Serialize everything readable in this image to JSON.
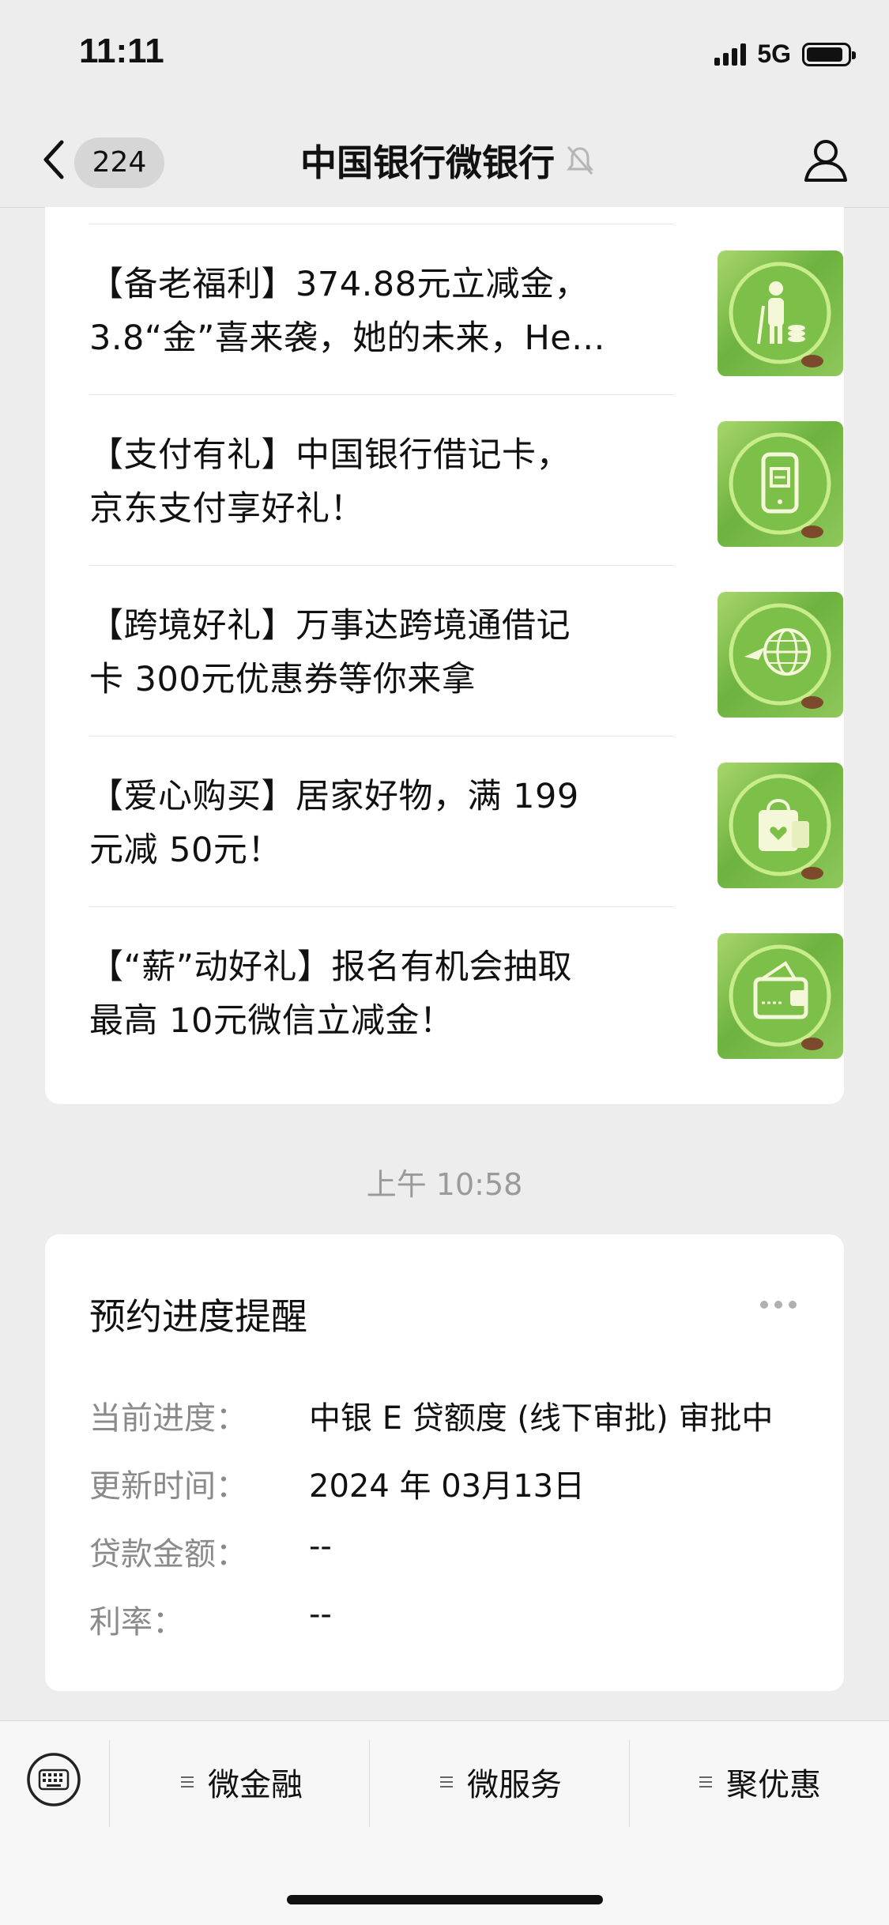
{
  "status_bar": {
    "time": "11:11",
    "network": "5G",
    "battery_level": 0.9
  },
  "nav": {
    "unread_count": "224",
    "title": "中国银行微银行",
    "icons": [
      "back-icon",
      "mute-bell-icon",
      "profile-icon"
    ]
  },
  "articles": [
    {
      "line1": "【备老福利】374.88元立减金，",
      "line2": "3.8“金”喜来袭，她的未来，He...",
      "icon": "elderly-person-coins-icon"
    },
    {
      "line1": "【支付有礼】中国银行借记卡，",
      "line2": "京东支付享好礼！",
      "icon": "mobile-payment-icon"
    },
    {
      "line1": "【跨境好礼】万事达跨境通借记",
      "line2": "卡 300元优惠券等你来拿",
      "icon": "globe-airplane-icon"
    },
    {
      "line1": "【爱心购买】居家好物，满 199",
      "line2": "元减 50元！",
      "icon": "shopping-bag-heart-icon"
    },
    {
      "line1": "【“薪”动好礼】报名有机会抽取",
      "line2": "最高 10元微信立减金！",
      "icon": "wallet-icon"
    }
  ],
  "time_separator": "上午 10:58",
  "reminder": {
    "title": "预约进度提醒",
    "fields": [
      {
        "label": "当前进度：",
        "value": "中银 E 贷额度 (线下审批) 审批中"
      },
      {
        "label": "更新时间：",
        "value": "2024 年 03月13日"
      },
      {
        "label": "贷款金额：",
        "value": "--"
      },
      {
        "label": "利率：",
        "value": "--"
      }
    ]
  },
  "bottom_menu": {
    "items": [
      "微金融",
      "微服务",
      "聚优惠"
    ],
    "keyboard_icon": "keyboard-icon"
  },
  "colors": {
    "background": "#ededed",
    "card": "#ffffff",
    "thumb_green": "#6db33f",
    "label_gray": "#8a8a8a"
  }
}
